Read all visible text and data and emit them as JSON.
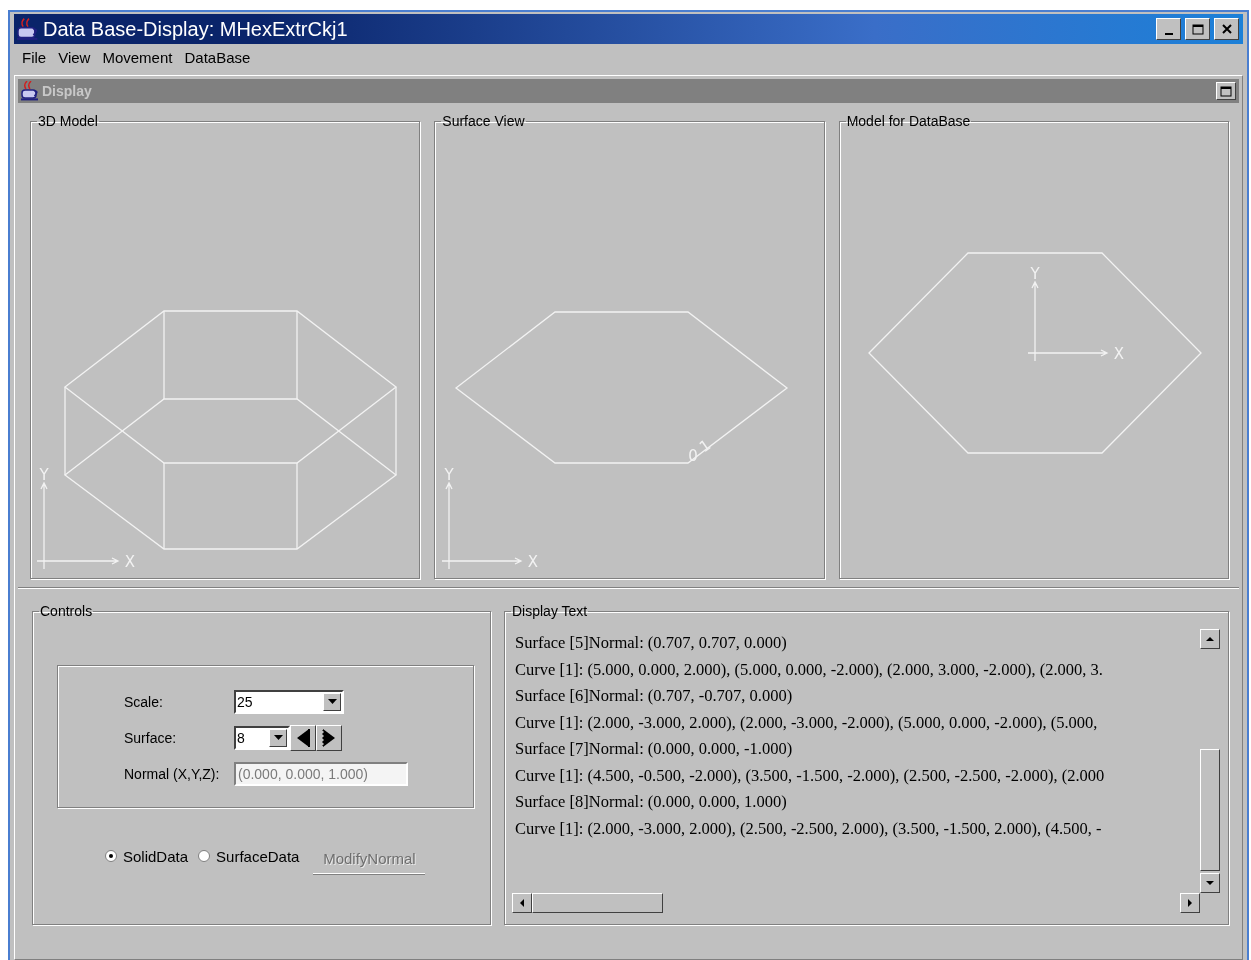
{
  "window": {
    "title": "Data Base-Display: MHexExtrCkj1"
  },
  "menu": [
    "File",
    "View",
    "Movement",
    "DataBase"
  ],
  "internal_frame": {
    "title": "Display"
  },
  "views": [
    {
      "kind": "model3d",
      "title": "3D Model",
      "axis_x": "X",
      "axis_y": "Y"
    },
    {
      "kind": "surface",
      "title": "Surface View",
      "axis_x": "X",
      "axis_y": "Y",
      "vertex_labels": [
        "0",
        "1"
      ]
    },
    {
      "kind": "database",
      "title": "Model for DataBase",
      "axis_x": "X",
      "axis_y": "Y"
    }
  ],
  "controls": {
    "title": "Controls",
    "scale": {
      "label": "Scale:",
      "value": "25"
    },
    "surface": {
      "label": "Surface:",
      "value": "8"
    },
    "normal": {
      "label": "Normal (X,Y,Z):",
      "value": "(0.000, 0.000, 1.000)",
      "disabled": true
    },
    "modes": [
      {
        "label": "SolidData",
        "selected": true
      },
      {
        "label": "SurfaceData",
        "selected": false
      }
    ],
    "modify_button": {
      "label": "ModifyNormal",
      "disabled": true
    }
  },
  "display_text": {
    "title": "Display Text",
    "lines": [
      "Surface [5]Normal: (0.707, 0.707, 0.000)",
      "Curve [1]: (5.000, 0.000, 2.000), (5.000, 0.000, -2.000), (2.000, 3.000, -2.000), (2.000, 3.",
      "Surface [6]Normal: (0.707, -0.707, 0.000)",
      "Curve [1]: (2.000, -3.000, 2.000), (2.000, -3.000, -2.000), (5.000, 0.000, -2.000), (5.000,",
      "Surface [7]Normal: (0.000, 0.000, -1.000)",
      "Curve [1]: (4.500, -0.500, -2.000), (3.500, -1.500, -2.000), (2.500, -2.500, -2.000), (2.000",
      "Surface [8]Normal: (0.000, 0.000, 1.000)",
      "Curve [1]: (2.000, -3.000, 2.000), (2.500, -2.500, 2.000), (3.500, -1.500, 2.000), (4.500, -"
    ]
  }
}
